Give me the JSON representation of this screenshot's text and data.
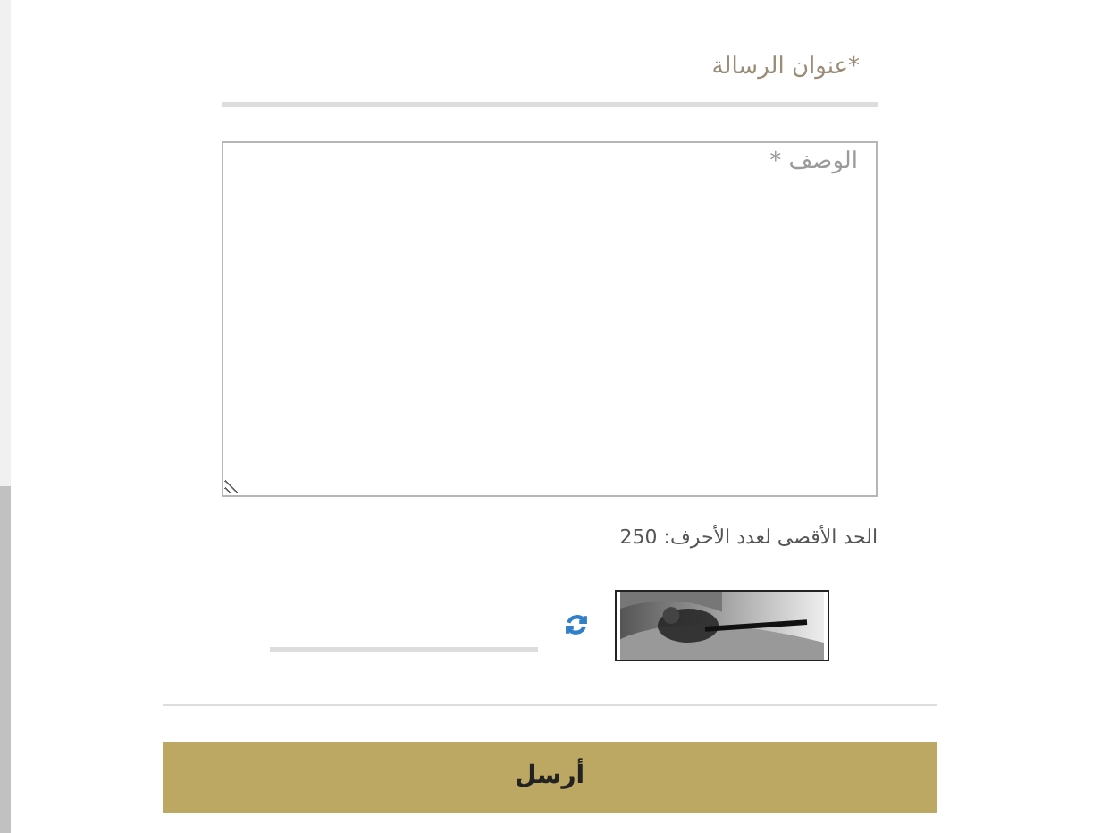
{
  "form": {
    "subject": {
      "placeholder": "*عنوان الرسالة"
    },
    "description": {
      "placeholder": "الوصف *"
    },
    "char_limit": "الحد الأقصى لعدد الأحرف: 250",
    "submit": "أرسل"
  }
}
